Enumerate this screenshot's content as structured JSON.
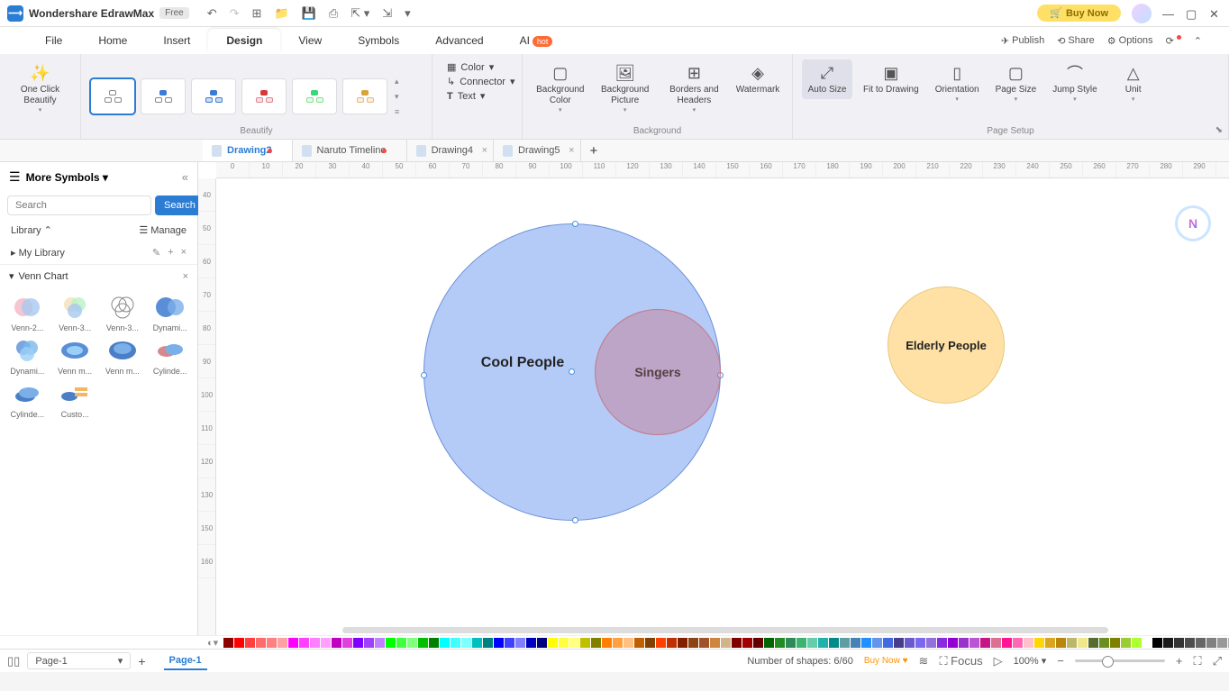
{
  "app": {
    "name": "Wondershare EdrawMax",
    "badge": "Free",
    "buyNow": "Buy Now"
  },
  "menus": {
    "file": "File",
    "home": "Home",
    "insert": "Insert",
    "design": "Design",
    "view": "View",
    "symbols": "Symbols",
    "advanced": "Advanced",
    "ai": "AI",
    "aiBadge": "hot"
  },
  "menuRight": {
    "publish": "Publish",
    "share": "Share",
    "options": "Options"
  },
  "ribbon": {
    "oneClick": "One Click\nBeautify",
    "beautifyLabel": "Beautify",
    "color": "Color",
    "connector": "Connector",
    "text": "Text",
    "bgColor": "Background\nColor",
    "bgPicture": "Background\nPicture",
    "borders": "Borders and\nHeaders",
    "watermark": "Watermark",
    "bgLabel": "Background",
    "autoSize": "Auto\nSize",
    "fitDraw": "Fit to\nDrawing",
    "orientation": "Orientation",
    "pageSize": "Page\nSize",
    "jumpStyle": "Jump\nStyle",
    "unit": "Unit",
    "pageSetupLabel": "Page Setup"
  },
  "tabs": [
    {
      "name": "Drawing2",
      "modified": true,
      "active": true
    },
    {
      "name": "Naruto Timeline",
      "modified": true
    },
    {
      "name": "Drawing4",
      "closable": true
    },
    {
      "name": "Drawing5",
      "closable": true
    }
  ],
  "leftPanel": {
    "title": "More Symbols",
    "searchPlaceholder": "Search",
    "searchBtn": "Search",
    "library": "Library",
    "manage": "Manage",
    "myLibrary": "My Library",
    "vennChart": "Venn Chart",
    "shapes": [
      "Venn-2...",
      "Venn-3...",
      "Venn-3...",
      "Dynami...",
      "Dynami...",
      "Venn m...",
      "Venn m...",
      "Cylinde...",
      "Cylinde...",
      "Custo..."
    ]
  },
  "rulerH": [
    "0",
    "10",
    "20",
    "30",
    "40",
    "50",
    "60",
    "70",
    "80",
    "90",
    "100",
    "110",
    "120",
    "130",
    "140",
    "150",
    "160",
    "170",
    "180",
    "190",
    "200",
    "210",
    "220",
    "230",
    "240",
    "250",
    "260",
    "270",
    "280",
    "290"
  ],
  "rulerV": [
    "40",
    "50",
    "60",
    "70",
    "80",
    "90",
    "100",
    "110",
    "120",
    "130",
    "150",
    "160"
  ],
  "diagram": {
    "circle1": "Cool People",
    "circle2": "Singers",
    "circle3": "Elderly People"
  },
  "status": {
    "pageSelector": "Page-1",
    "pageName": "Page-1",
    "shapes": "Number of shapes: 6/60",
    "buyNow": "Buy Now",
    "focus": "Focus",
    "zoom": "100%"
  }
}
